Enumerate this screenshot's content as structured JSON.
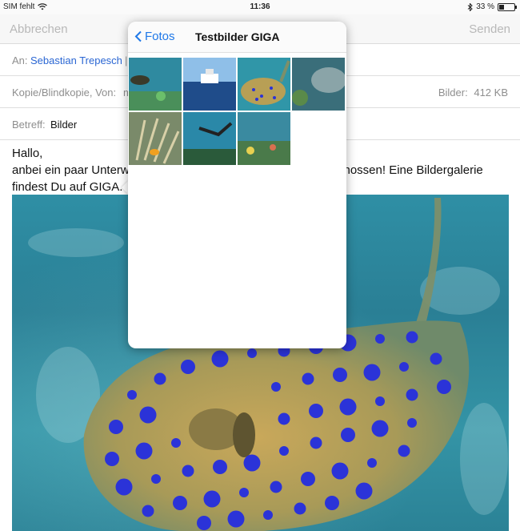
{
  "statusbar": {
    "carrier": "SIM fehlt",
    "time": "11:36",
    "battery_text": "33 %",
    "battery_level": 0.33,
    "icons": [
      "wifi-icon",
      "bluetooth-icon",
      "battery-icon"
    ]
  },
  "navbar": {
    "cancel": "Abbrechen",
    "send": "Senden"
  },
  "fields": {
    "to_label": "An:",
    "to_value": "Sebastian Trepesch",
    "cc_label": "Kopie/Blindkopie, Von:",
    "cc_value_fragment": "m",
    "images_label": "Bilder:",
    "images_size": "412 KB",
    "subject_label": "Betreff:",
    "subject_value": "Bilder"
  },
  "body": {
    "line1": "Hallo,",
    "line2_left": "anbei ein paar Unterwa",
    "line2_right": "chossen! Eine Bildergalerie",
    "line3": "findest Du auf GIGA."
  },
  "popover": {
    "back_label": "Fotos",
    "title": "Testbilder GIGA",
    "thumbnails": [
      {
        "name": "thumb-reef-fish"
      },
      {
        "name": "thumb-boat"
      },
      {
        "name": "thumb-stingray"
      },
      {
        "name": "thumb-moray-eel"
      },
      {
        "name": "thumb-anemone-clownfish"
      },
      {
        "name": "thumb-diver"
      },
      {
        "name": "thumb-coral-fish"
      }
    ]
  },
  "colors": {
    "link_blue": "#1f78e8",
    "recipient_blue": "#2a66d3",
    "disabled_gray": "#b8b8b8",
    "water": "#2f8fa5",
    "spot_blue": "#2b33d8"
  }
}
